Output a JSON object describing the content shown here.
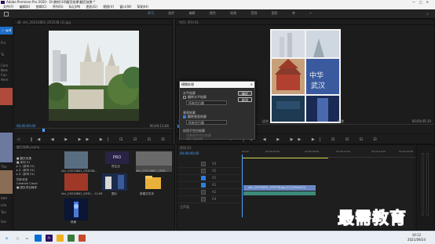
{
  "window": {
    "title": "Adobe Premiere Pro 2020 - D:\\教材\\10\\翻页效果\\翻页效果 *",
    "controls": [
      "—",
      "□",
      "✕"
    ]
  },
  "menubar": [
    "文件(F)",
    "编辑(E)",
    "剪辑(C)",
    "序列(S)",
    "标记(M)",
    "图形(G)",
    "视图(V)",
    "窗口(W)",
    "帮助(H)"
  ],
  "workspace_tabs": [
    "学习",
    "组件",
    "编辑",
    "颜色",
    "效果",
    "音频",
    "图形",
    "库",
    "»"
  ],
  "workspace_active": "学习",
  "left_strip": {
    "blue_label": "✓ upd",
    "items": [
      "Fra",
      "Tu",
      "Com",
      "New",
      "Can",
      "Here",
      "The",
      "tate",
      "Lite",
      "Tea",
      "Sav"
    ]
  },
  "source_monitor": {
    "header": "源: vlrc_20210801_053538 (2).jpg",
    "timecode_left": "00;00;00;00",
    "timecode_right": "00;00;11;06",
    "controls": "◁ ‖◀ ◀ ▶ ▶▶ ▶| ⊡ ⊡ ⊡ ⊡"
  },
  "program_monitor": {
    "header": "节目: 序列 01",
    "timecode_left": "00;00;00;00",
    "fit": "适合",
    "full": "完整",
    "timecode_right": "00;00;05;10",
    "controls": "◁ ‖◀ ◀ ▶ ▶▶ ▶| ⊡ ⊡ ⊡ ⊡"
  },
  "dialog": {
    "title": "模糊处理",
    "close": "×",
    "section1_title": "水平轮廓",
    "check1": "翻转水平轮廓",
    "select1": "所有空白属",
    "section2_title": "垂直轮廓",
    "check2": "翻转垂直轮廓",
    "select2": "所有空白属",
    "section3_title": "仅用于空白轮廓",
    "dim1": "对称合并空白轮廓",
    "dim2": "自定义空白轮廓",
    "ok": "确定",
    "cancel": "取消"
  },
  "project_panel": {
    "header": "翻页效果.prproj",
    "tree": [
      "■ 翻页效果",
      "  ■ 序列 01",
      "  ▸ 1. (序列 01)",
      "  ▸ 2. (序列 01)",
      "  ▸ 3. (序列 01)",
      "同步状态",
      "Creative Cloud",
      "  ■ 团队项目媒体"
    ],
    "items": [
      {
        "label": "vlrc_20210801_053538..."
      },
      {
        "label": "夜生活"
      },
      {
        "label": "vlrc_20210801_0532..."
      },
      {
        "label": "vlrc_20210801_0532... 11:06"
      },
      {
        "label": "图片"
      },
      {
        "label": "新建文件夹"
      },
      {
        "label": "夜景"
      }
    ]
  },
  "timeline": {
    "header": "序列 01",
    "timecode": "00;00;00;00",
    "ruler": [
      "00;00",
      "00;00;04;00",
      "00;00;08;00",
      "00;00;12;00",
      "00;00;16;00",
      "00;00;20;00"
    ],
    "tracks": [
      "V3",
      "V2",
      "V1",
      "A1",
      "A2",
      "A3"
    ],
    "clip_label": "vlrc_20210801_053538.jpg [V] [VimeoC2]",
    "master": "主声道"
  },
  "taskbar": {
    "time": "16:12",
    "date": "2021/09/24"
  },
  "watermark": "最需教育",
  "colors": {
    "accent": "#2d7ee0",
    "timecode": "#4aa2ff",
    "clip_video": "#6b89c6",
    "clip_audio": "#3d8a7a"
  }
}
